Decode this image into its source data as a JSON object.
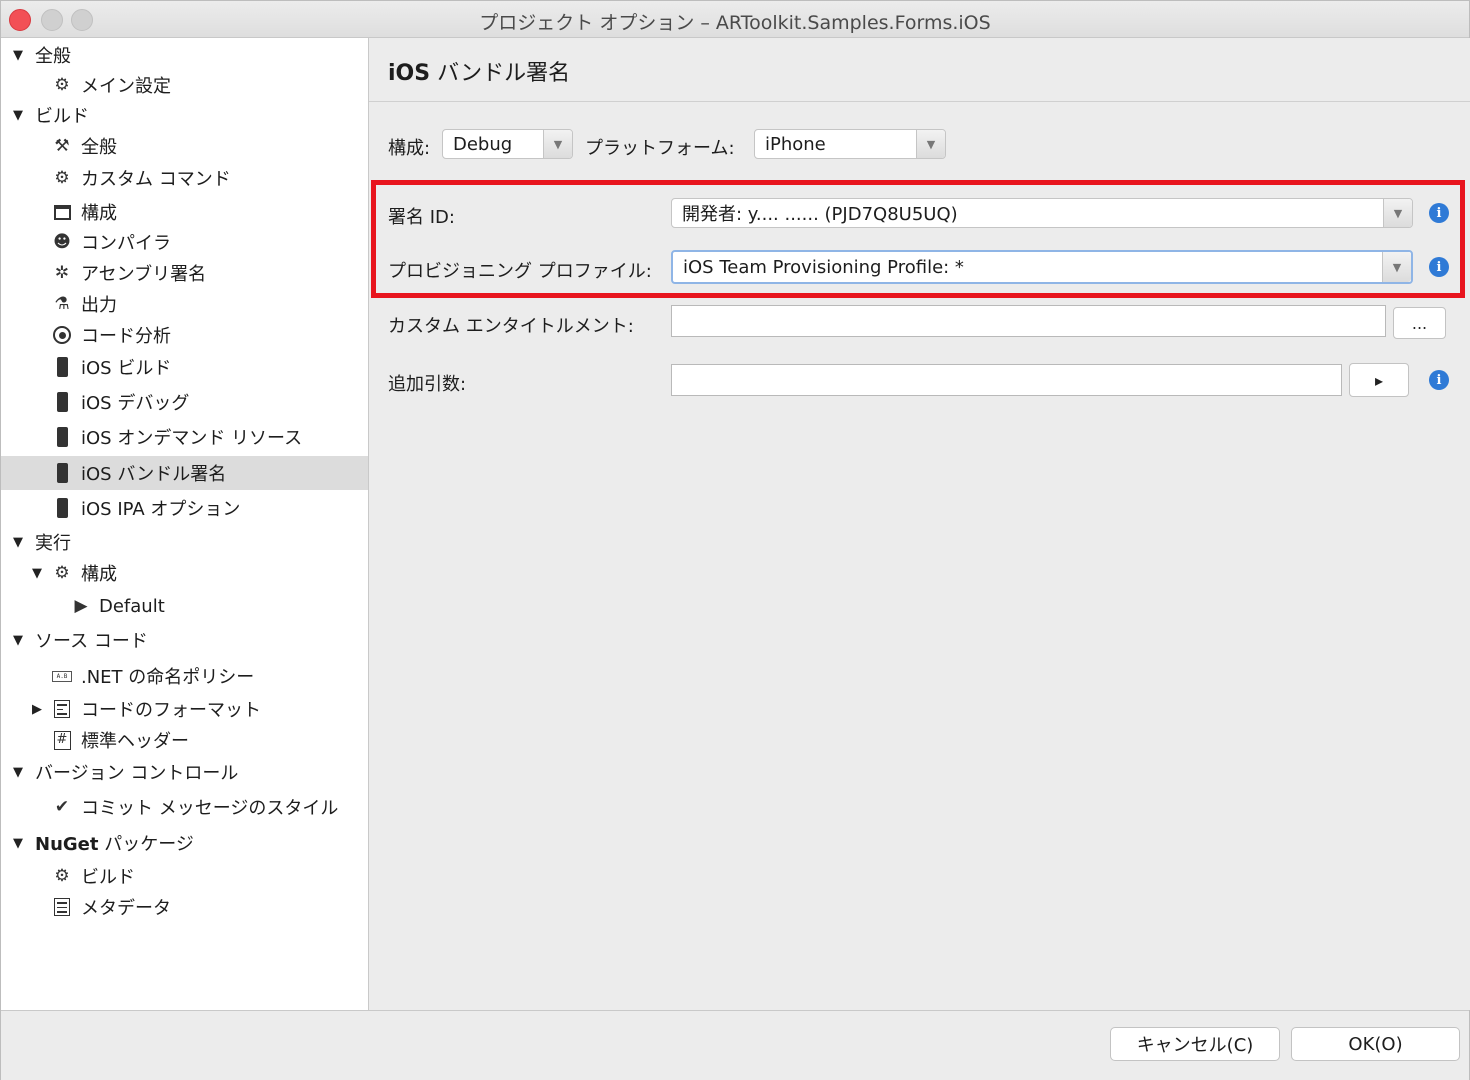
{
  "window": {
    "title": "プロジェクト オプション – ARToolkit.Samples.Forms.iOS"
  },
  "sidebar": {
    "items": [
      {
        "label": "全般",
        "icon": "triangle-down-icon"
      },
      {
        "label": "メイン設定",
        "icon": "gear-icon"
      },
      {
        "label": "ビルド",
        "icon": "triangle-down-icon"
      },
      {
        "label": "全般",
        "icon": "hammer-icon"
      },
      {
        "label": "カスタム コマンド",
        "icon": "gear-icon"
      },
      {
        "label": "構成",
        "icon": "window-icon"
      },
      {
        "label": "コンパイラ",
        "icon": "robot-icon"
      },
      {
        "label": "アセンブリ署名",
        "icon": "badge-icon"
      },
      {
        "label": "出力",
        "icon": "flask-icon"
      },
      {
        "label": "コード分析",
        "icon": "target-icon"
      },
      {
        "label": "iOS ビルド",
        "icon": "phone-icon"
      },
      {
        "label": "iOS デバッグ",
        "icon": "phone-icon"
      },
      {
        "label": "iOS オンデマンド リソース",
        "icon": "phone-icon"
      },
      {
        "label": "iOS バンドル署名",
        "icon": "phone-icon",
        "selected": true
      },
      {
        "label": "iOS IPA オプション",
        "icon": "phone-icon"
      },
      {
        "label": "実行",
        "icon": "triangle-down-icon"
      },
      {
        "label": "構成",
        "icon": "gear-icon"
      },
      {
        "label": "Default",
        "icon": "play-icon"
      },
      {
        "label": "ソース コード",
        "icon": "triangle-down-icon"
      },
      {
        "label": ".NET の命名ポリシー",
        "icon": "naming-icon"
      },
      {
        "label": "コードのフォーマット",
        "icon": "format-icon"
      },
      {
        "label": "標準ヘッダー",
        "icon": "hash-icon"
      },
      {
        "label": "バージョン コントロール",
        "icon": "triangle-down-icon"
      },
      {
        "label": "コミット メッセージのスタイル",
        "icon": "check-circle-icon"
      },
      {
        "label_bold": "NuGet",
        "label": " パッケージ",
        "icon": "triangle-down-icon"
      },
      {
        "label": "ビルド",
        "icon": "gear-icon"
      },
      {
        "label": "メタデータ",
        "icon": "document-icon"
      }
    ]
  },
  "main": {
    "title_prefix": "iOS",
    "title_rest": " バンドル署名",
    "config_label": "構成:",
    "config_value": "Debug",
    "platform_label": "プラットフォーム:",
    "platform_value": "iPhone",
    "signing_label": "署名 ID:",
    "signing_value": "開発者: y.... ...... (PJD7Q8U5UQ)",
    "provisioning_label": "プロビジョニング プロファイル:",
    "provisioning_value": "iOS Team Provisioning Profile: *",
    "entitlements_label": "カスタム エンタイトルメント:",
    "entitlements_value": "",
    "entitlements_button": "...",
    "args_label": "追加引数:",
    "args_value": "",
    "args_button": "▸",
    "info_glyph": "i",
    "highlight_color": "#e8151e"
  },
  "footer": {
    "cancel_label": "キャンセル(C)",
    "ok_label": "OK(O)"
  }
}
